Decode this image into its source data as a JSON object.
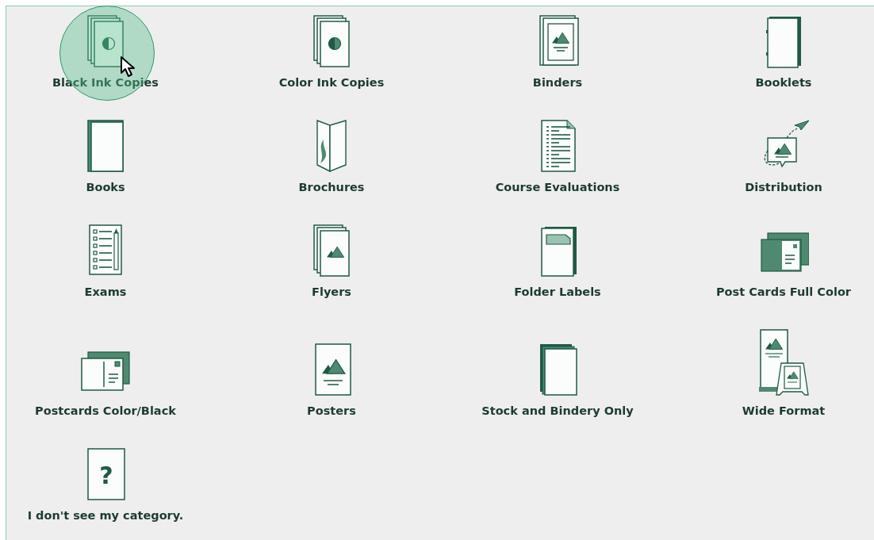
{
  "categories": [
    {
      "label": "Black Ink Copies",
      "kind": "copies-mono",
      "selected": true
    },
    {
      "label": "Color Ink Copies",
      "kind": "copies-color",
      "selected": false
    },
    {
      "label": "Binders",
      "kind": "binder",
      "selected": false
    },
    {
      "label": "Booklets",
      "kind": "booklet",
      "selected": false
    },
    {
      "label": "Books",
      "kind": "book",
      "selected": false
    },
    {
      "label": "Brochures",
      "kind": "brochure",
      "selected": false
    },
    {
      "label": "Course Evaluations",
      "kind": "document",
      "selected": false
    },
    {
      "label": "Distribution",
      "kind": "distribution",
      "selected": false
    },
    {
      "label": "Exams",
      "kind": "exam",
      "selected": false
    },
    {
      "label": "Flyers",
      "kind": "flyer",
      "selected": false
    },
    {
      "label": "Folder Labels",
      "kind": "folder-label",
      "selected": false
    },
    {
      "label": "Post Cards Full Color",
      "kind": "postcard-full",
      "selected": false
    },
    {
      "label": "Postcards Color/Black",
      "kind": "postcard",
      "selected": false
    },
    {
      "label": "Posters",
      "kind": "poster",
      "selected": false
    },
    {
      "label": "Stock and Bindery Only",
      "kind": "stock",
      "selected": false
    },
    {
      "label": "Wide Format",
      "kind": "wide-format",
      "selected": false
    },
    {
      "label": "I don't see my category.",
      "kind": "unknown",
      "glyph": "?",
      "selected": false
    }
  ]
}
